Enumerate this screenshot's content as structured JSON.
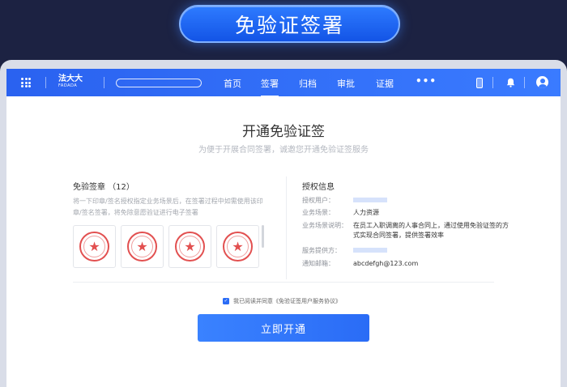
{
  "banner": {
    "title": "免验证签署"
  },
  "nav": {
    "logo_cn": "法大大",
    "logo_en": "FADADA",
    "items": [
      "首页",
      "签署",
      "归档",
      "审批",
      "证据"
    ],
    "active_index": 1,
    "more": "•••"
  },
  "page": {
    "title": "开通免验证签",
    "subtitle": "为便于开展合同签署，诚邀您开通免验证签服务"
  },
  "seals": {
    "heading": "免验签章 （12）",
    "description": "将一下印章/签名授权指定业务场景后，在签署过程中如需使用该印章/签名签署，将免除意愿验证进行电子签署",
    "count_visible": 4
  },
  "auth": {
    "heading": "授权信息",
    "rows": [
      {
        "label": "授权用户：",
        "value": "",
        "redacted": true
      },
      {
        "label": "业务场景：",
        "value": "人力资源"
      },
      {
        "label": "业务场景说明：",
        "value": "在员工入职调离的人事合同上，通过使用免验证签的方式实现合同签署，提供签署效率"
      },
      {
        "label": "服务提供方：",
        "value": "",
        "redacted": true
      },
      {
        "label": "通知邮箱：",
        "value": "abcdefgh@123.com"
      }
    ]
  },
  "agreement": {
    "checked": true,
    "prefix": "我已阅读并同意",
    "link": "《免验证签用户服务协议》"
  },
  "cta": {
    "label": "立即开通"
  },
  "colors": {
    "primary": "#2a6cf6",
    "seal_red": "#e25050",
    "bg": "#1c2242"
  }
}
